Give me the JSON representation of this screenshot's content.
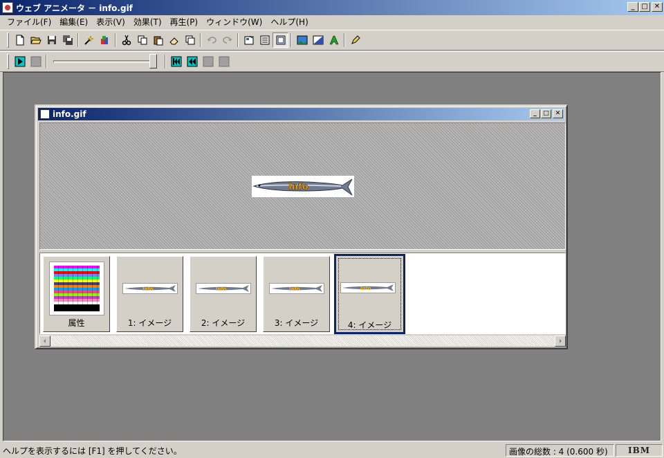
{
  "window": {
    "title": "ウェブ アニメータ － info.gif"
  },
  "menu": [
    "ファイル(F)",
    "編集(E)",
    "表示(V)",
    "効果(T)",
    "再生(P)",
    "ウィンドウ(W)",
    "ヘルプ(H)"
  ],
  "document": {
    "title": "info.gif",
    "preview_text": "Info"
  },
  "frames": [
    {
      "label": "属性"
    },
    {
      "label": "1: イメージ",
      "thumb_text": "Info"
    },
    {
      "label": "2: イメージ",
      "thumb_text": "Info"
    },
    {
      "label": "3: イメージ",
      "thumb_text": "Info"
    },
    {
      "label": "4: イメージ",
      "thumb_text": "Info"
    }
  ],
  "status": {
    "help": "ヘルプを表示するには [F1] を押してください。",
    "count": "画像の総数 : 4 (0.600 秒)",
    "logo": "IBM"
  },
  "colors": {
    "title_start": "#0a246a",
    "title_end": "#a6caf0",
    "workspace": "#808080",
    "face": "#d4d0c8"
  }
}
